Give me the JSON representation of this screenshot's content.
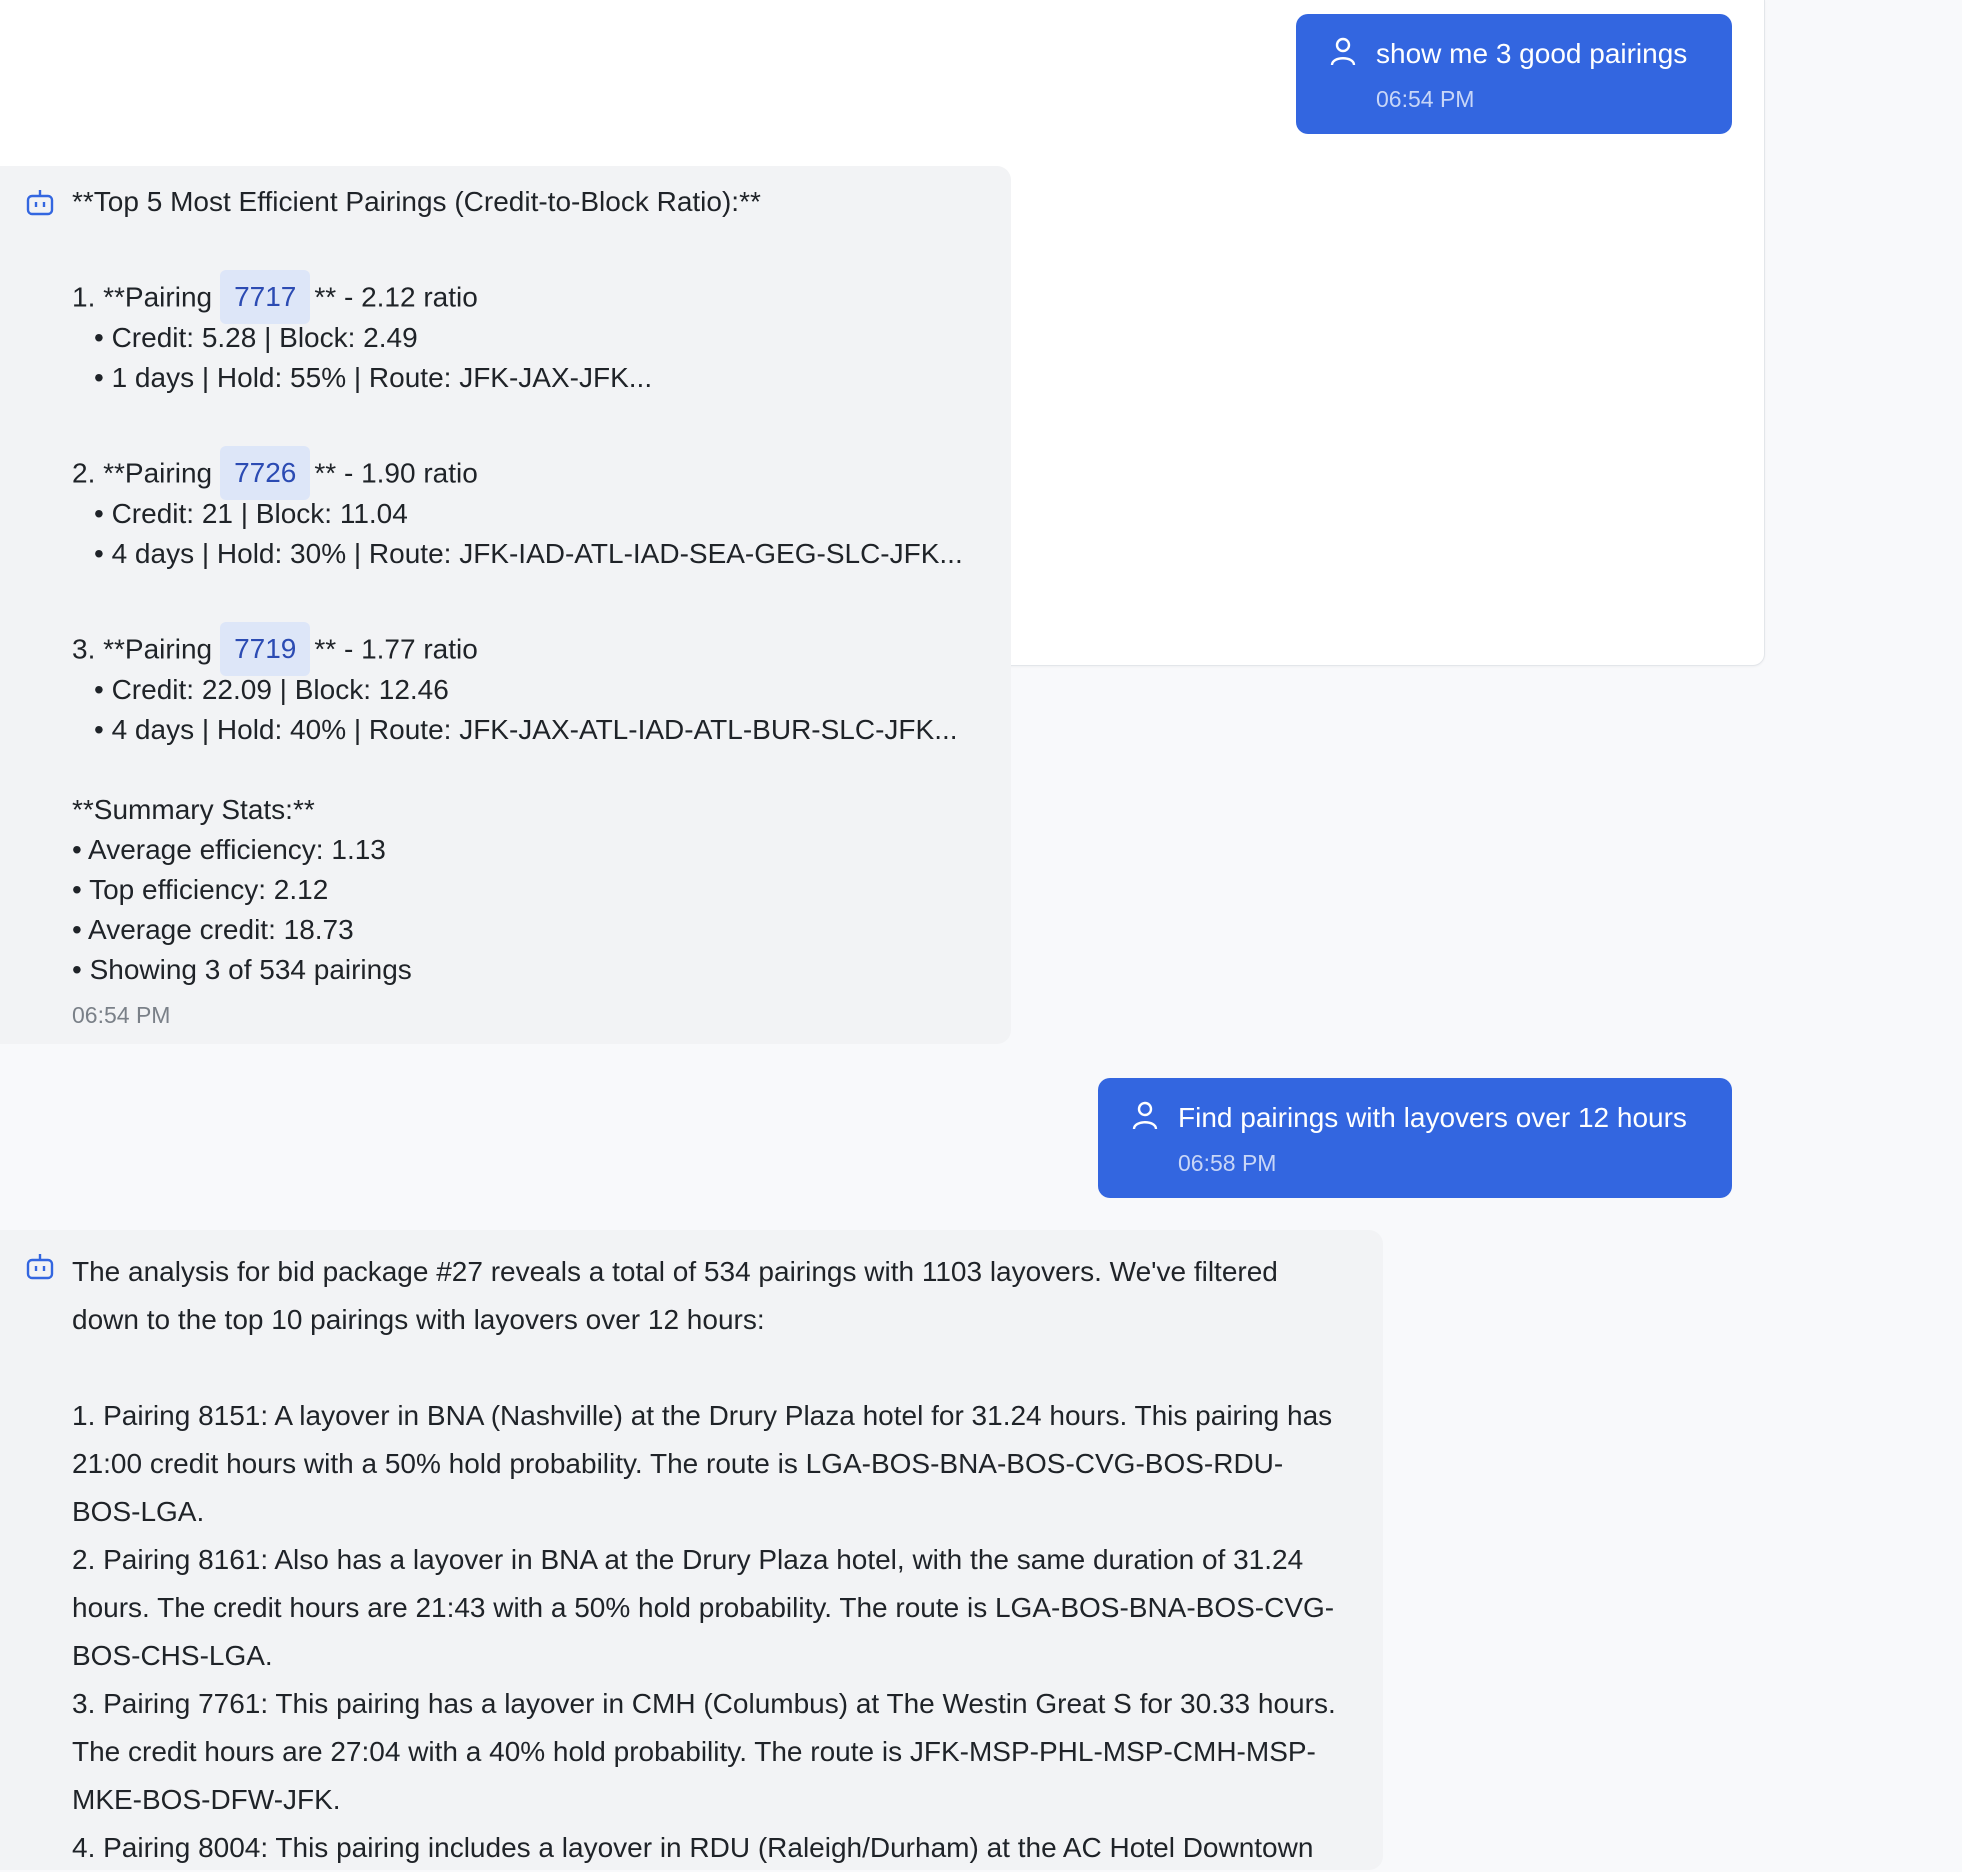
{
  "messages": {
    "user1": {
      "text": "show me 3 good pairings",
      "time": "06:54 PM"
    },
    "bot1": {
      "heading": "**Top 5 Most Efficient Pairings (Credit-to-Block Ratio):**",
      "pairings": [
        {
          "prefix": "1. **Pairing",
          "id": "7717",
          "suffix": "** - 2.12 ratio",
          "detail1": "• Credit: 5.28 | Block: 2.49",
          "detail2": "• 1 days | Hold: 55% | Route: JFK-JAX-JFK..."
        },
        {
          "prefix": "2. **Pairing",
          "id": "7726",
          "suffix": "** - 1.90 ratio",
          "detail1": "• Credit: 21 | Block: 11.04",
          "detail2": "• 4 days | Hold: 30% | Route: JFK-IAD-ATL-IAD-SEA-GEG-SLC-JFK..."
        },
        {
          "prefix": "3. **Pairing",
          "id": "7719",
          "suffix": "** - 1.77 ratio",
          "detail1": "• Credit: 22.09 | Block: 12.46",
          "detail2": "• 4 days | Hold: 40% | Route: JFK-JAX-ATL-IAD-ATL-BUR-SLC-JFK..."
        }
      ],
      "summary_heading": "**Summary Stats:**",
      "summary": [
        "• Average efficiency: 1.13",
        "• Top efficiency: 2.12",
        "• Average credit: 18.73",
        "• Showing 3 of 534 pairings"
      ],
      "time": "06:54 PM"
    },
    "user2": {
      "text": "Find pairings with layovers over 12 hours",
      "time": "06:58 PM"
    },
    "bot2": {
      "intro": "The analysis for bid package #27 reveals a total of 534 pairings with 1103 layovers. We've filtered down to the top 10 pairings with layovers over 12 hours:",
      "items": [
        "1. Pairing 8151: A layover in BNA (Nashville) at the Drury Plaza hotel for 31.24 hours. This pairing has 21:00 credit hours with a 50% hold probability. The route is LGA-BOS-BNA-BOS-CVG-BOS-RDU-BOS-LGA.",
        "2. Pairing 8161: Also has a layover in BNA at the Drury Plaza hotel, with the same duration of 31.24 hours. The credit hours are 21:43 with a 50% hold probability. The route is LGA-BOS-BNA-BOS-CVG-BOS-CHS-LGA.",
        "3. Pairing 7761: This pairing has a layover in CMH (Columbus) at The Westin Great S for 30.33 hours. The credit hours are 27:04 with a 40% hold probability. The route is JFK-MSP-PHL-MSP-CMH-MSP-MKE-BOS-DFW-JFK.",
        "4. Pairing 8004: This pairing includes a layover in RDU (Raleigh/Durham) at the AC Hotel Downtown"
      ]
    }
  },
  "colors": {
    "user_bubble": "#3366e0",
    "bot_bubble": "#f2f3f5",
    "pill": "#dde6f8",
    "accent": "#2b4bb3"
  },
  "icons": {
    "user": "user-icon",
    "bot": "bot-icon"
  }
}
